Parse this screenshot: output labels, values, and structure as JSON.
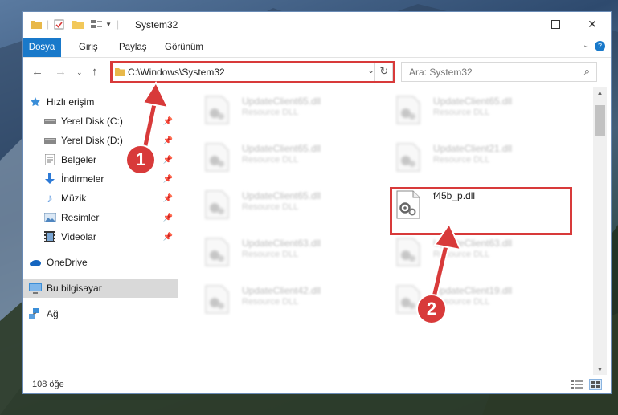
{
  "window": {
    "title": "System32",
    "status": "108 öğe"
  },
  "ribbon": {
    "tabs": [
      "Dosya",
      "Giriş",
      "Paylaş",
      "Görünüm"
    ]
  },
  "address": {
    "path": "C:\\Windows\\System32",
    "search_placeholder": "Ara: System32"
  },
  "sidebar": {
    "items": [
      {
        "label": "Hızlı erişim",
        "icon": "star-icon"
      },
      {
        "label": "Yerel Disk (C:)",
        "icon": "drive-icon"
      },
      {
        "label": "Yerel Disk (D:)",
        "icon": "drive-icon"
      },
      {
        "label": "Belgeler",
        "icon": "documents-icon"
      },
      {
        "label": "İndirmeler",
        "icon": "download-icon"
      },
      {
        "label": "Müzik",
        "icon": "music-icon"
      },
      {
        "label": "Resimler",
        "icon": "pictures-icon"
      },
      {
        "label": "Videolar",
        "icon": "videos-icon"
      },
      {
        "label": "OneDrive",
        "icon": "cloud-icon"
      },
      {
        "label": "Bu bilgisayar",
        "icon": "computer-icon"
      },
      {
        "label": "Ağ",
        "icon": "network-icon"
      }
    ]
  },
  "files": [
    {
      "name": "UpdateClient65.dll",
      "desc": "Resource DLL"
    },
    {
      "name": "UpdateClient65.dll",
      "desc": "Resource DLL"
    },
    {
      "name": "UpdateClient65.dll",
      "desc": "Resource DLL"
    },
    {
      "name": "UpdateClient21.dll",
      "desc": "Resource DLL"
    },
    {
      "name": "UpdateClient65.dll",
      "desc": "Resource DLL"
    },
    {
      "name": "f45b_p.dll",
      "desc": ""
    },
    {
      "name": "UpdateClient63.dll",
      "desc": "Resource DLL"
    },
    {
      "name": "UpdateClient63.dll",
      "desc": "Resource DLL"
    },
    {
      "name": "UpdateClient42.dll",
      "desc": "Resource DLL"
    },
    {
      "name": "UpdateClient19.dll",
      "desc": "Resource DLL"
    }
  ],
  "annotations": {
    "step1": "1",
    "step2": "2",
    "highlight_color": "#d83a3a"
  }
}
